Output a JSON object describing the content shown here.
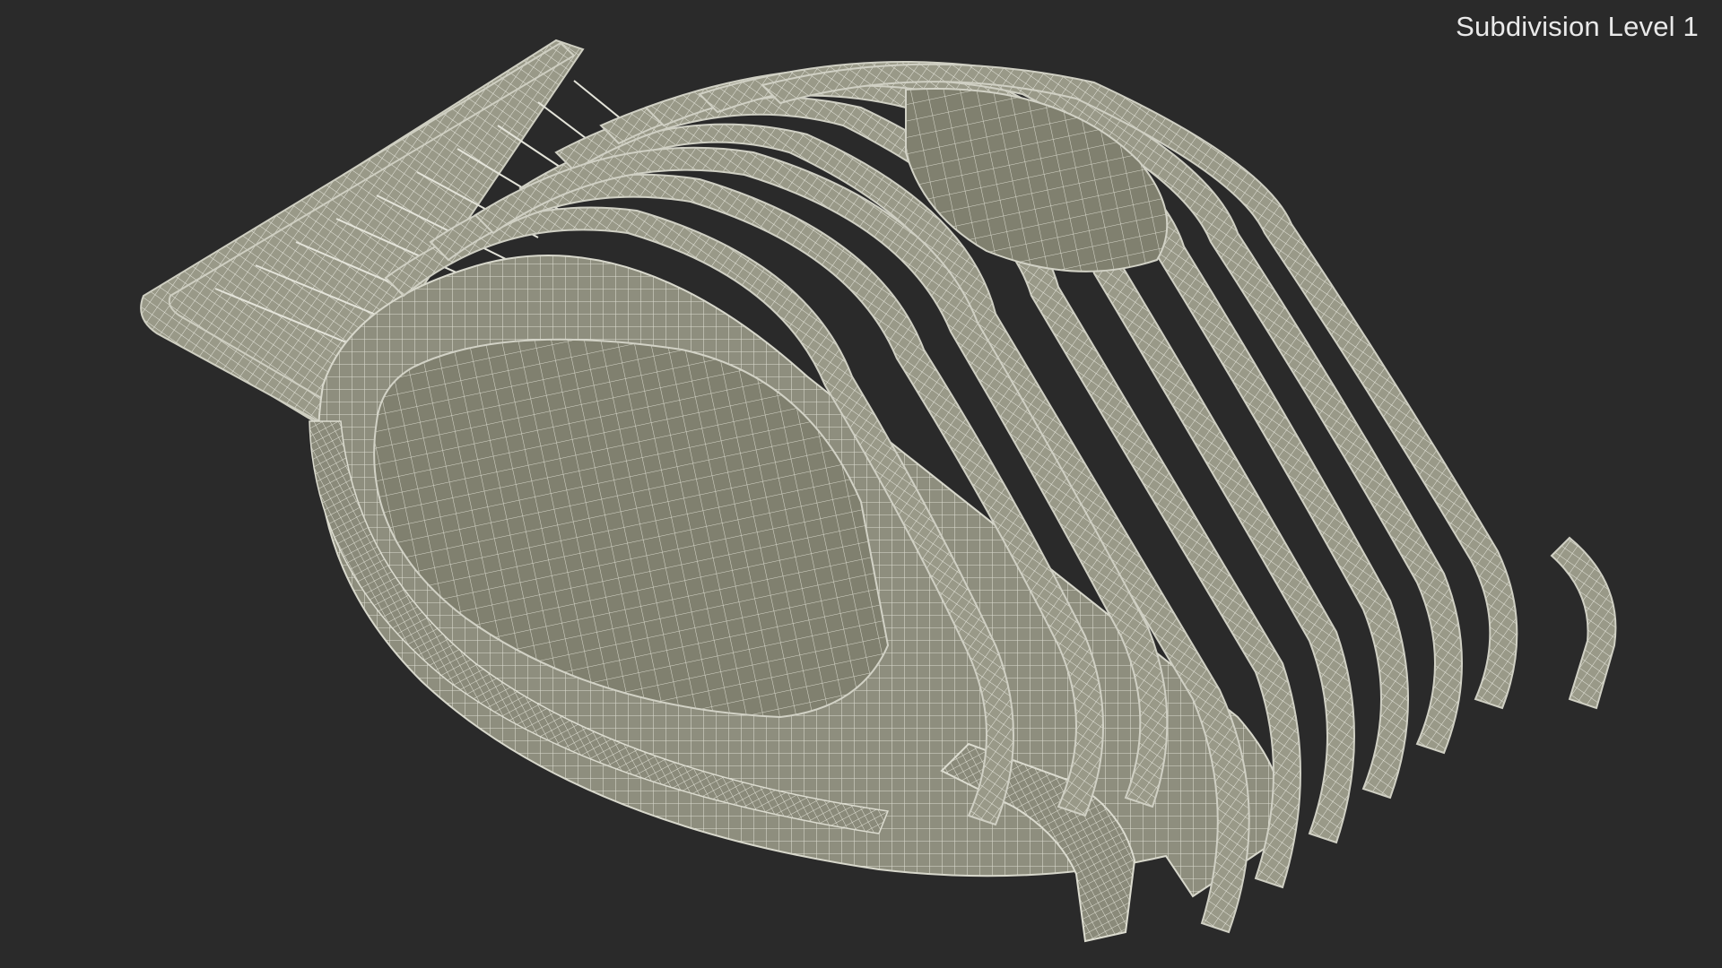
{
  "render": {
    "label": "Subdivision Level 1",
    "background_color": "#2a2a2a",
    "surface_color": "#8d8d7d",
    "wire_color": "#e4e4da"
  },
  "model": {
    "subject": "egg-slicer-wireframe-icon"
  }
}
